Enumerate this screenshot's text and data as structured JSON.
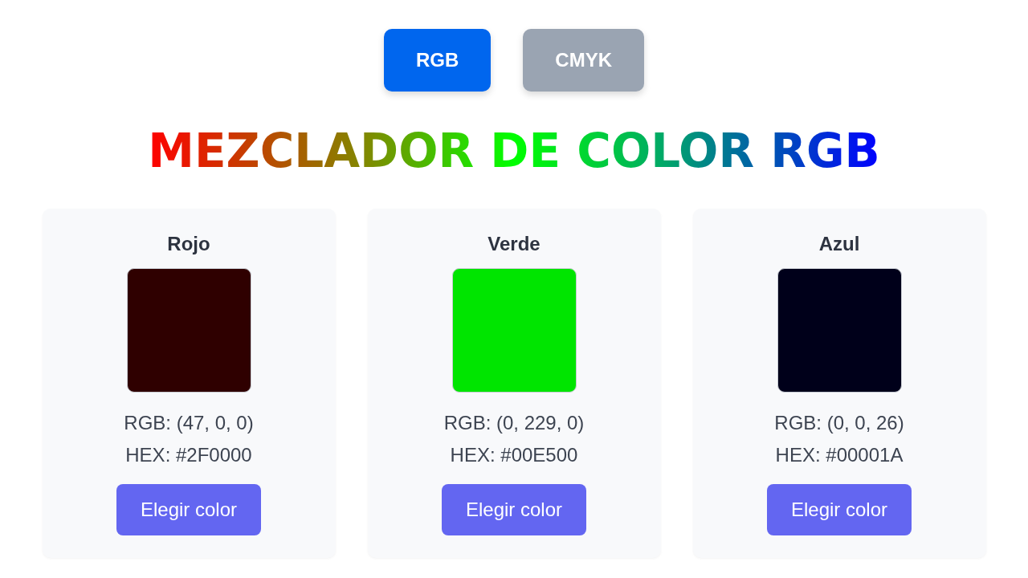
{
  "tabs": [
    {
      "label": "RGB",
      "selected": true
    },
    {
      "label": "CMYK",
      "selected": false
    }
  ],
  "title": "MEZCLADOR DE COLOR RGB",
  "channels": [
    {
      "name": "Rojo",
      "color": "#2f0000",
      "rgb": "RGB: (47, 0, 0)",
      "hex": "HEX: #2F0000",
      "button": "Elegir color"
    },
    {
      "name": "Verde",
      "color": "#00e500",
      "rgb": "RGB: (0, 229, 0)",
      "hex": "HEX: #00E500",
      "button": "Elegir color"
    },
    {
      "name": "Azul",
      "color": "#00001a",
      "rgb": "RGB: (0, 0, 26)",
      "hex": "HEX: #00001A",
      "button": "Elegir color"
    }
  ]
}
